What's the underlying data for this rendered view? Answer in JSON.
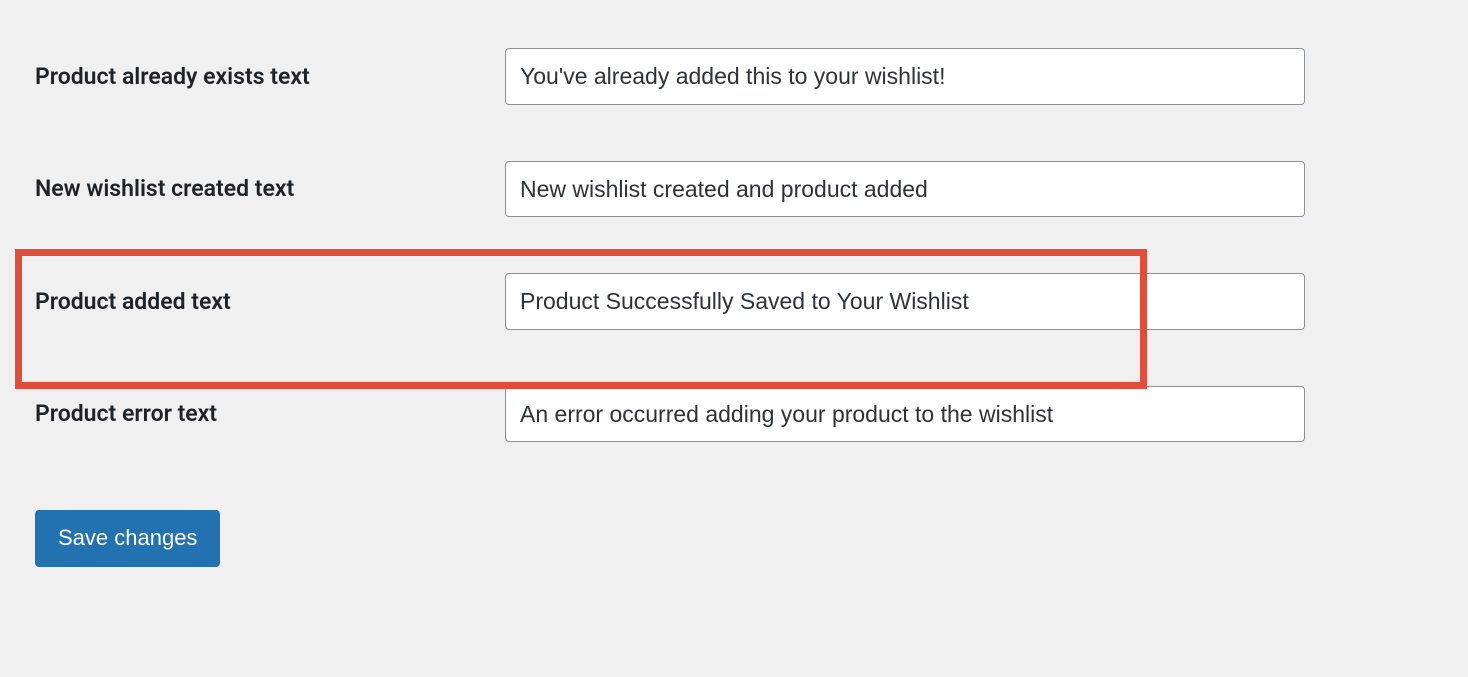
{
  "form": {
    "fields": [
      {
        "label": "Product already exists text",
        "value": "You've already added this to your wishlist!",
        "highlighted": false
      },
      {
        "label": "New wishlist created text",
        "value": "New wishlist created and product added",
        "highlighted": false
      },
      {
        "label": "Product added text",
        "value": "Product Successfully Saved to Your Wishlist",
        "highlighted": true
      },
      {
        "label": "Product error text",
        "value": "An error occurred adding your product to the wishlist",
        "highlighted": false
      }
    ],
    "submit_label": "Save changes"
  },
  "highlight_color": "#e14d3a",
  "button_color": "#2271b1"
}
